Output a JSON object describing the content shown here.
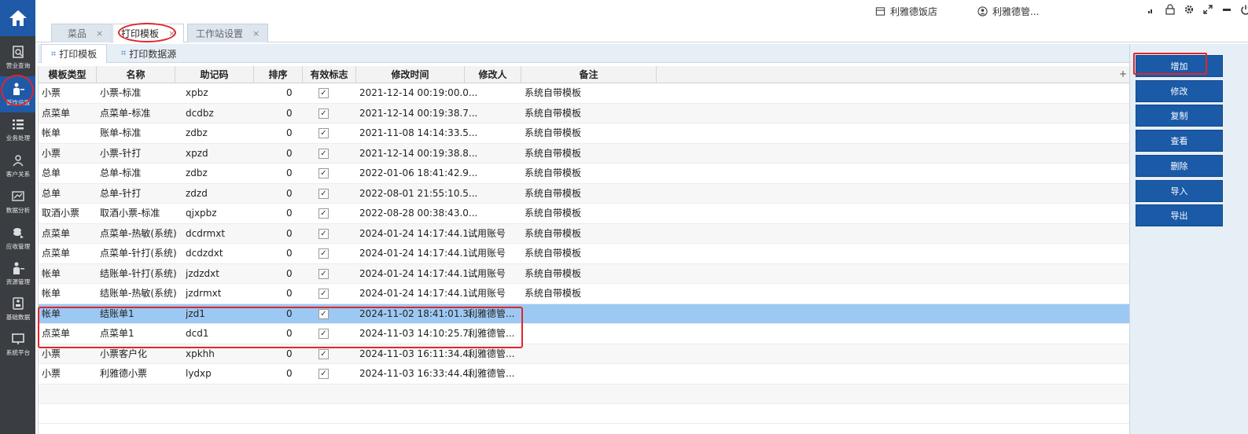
{
  "header": {
    "shop_name": "利雅德饭店",
    "user_name": "利雅德管..."
  },
  "nav": {
    "items": [
      {
        "label": "营业查询",
        "icon": "search-doc-icon"
      },
      {
        "label": "餐饮设置",
        "icon": "waiter-icon"
      },
      {
        "label": "业务处理",
        "icon": "list-icon"
      },
      {
        "label": "客户关系",
        "icon": "people-icon"
      },
      {
        "label": "数据分析",
        "icon": "chart-icon"
      },
      {
        "label": "应收管理",
        "icon": "coins-icon"
      },
      {
        "label": "资源管理",
        "icon": "person-icon"
      },
      {
        "label": "基础数据",
        "icon": "printer-icon"
      },
      {
        "label": "系统平台",
        "icon": "monitor-icon"
      }
    ]
  },
  "tabs": [
    {
      "label": "菜品",
      "close": "×"
    },
    {
      "label": "打印模板",
      "close": "×"
    },
    {
      "label": "工作站设置",
      "close": "×"
    }
  ],
  "subtabs": [
    {
      "label": "打印模板"
    },
    {
      "label": "打印数据源"
    }
  ],
  "table": {
    "columns": [
      "模板类型",
      "名称",
      "助记码",
      "排序",
      "有效标志",
      "修改时间",
      "修改人",
      "备注"
    ],
    "add_column": "+",
    "checkmark": "✓",
    "rows": [
      {
        "type": "小票",
        "name": "小票-标准",
        "code": "xpbz",
        "sort": "0",
        "time": "2021-12-14 00:19:00.0...",
        "modifier": "",
        "remark": "系统自带模板"
      },
      {
        "type": "点菜单",
        "name": "点菜单-标准",
        "code": "dcdbz",
        "sort": "0",
        "time": "2021-12-14 00:19:38.7...",
        "modifier": "",
        "remark": "系统自带模板"
      },
      {
        "type": "帐单",
        "name": "账单-标准",
        "code": "zdbz",
        "sort": "0",
        "time": "2021-11-08 14:14:33.5...",
        "modifier": "",
        "remark": "系统自带模板"
      },
      {
        "type": "小票",
        "name": "小票-针打",
        "code": "xpzd",
        "sort": "0",
        "time": "2021-12-14 00:19:38.8...",
        "modifier": "",
        "remark": "系统自带模板"
      },
      {
        "type": "总单",
        "name": "总单-标准",
        "code": "zdbz",
        "sort": "0",
        "time": "2022-01-06 18:41:42.9...",
        "modifier": "",
        "remark": "系统自带模板"
      },
      {
        "type": "总单",
        "name": "总单-针打",
        "code": "zdzd",
        "sort": "0",
        "time": "2022-08-01 21:55:10.5...",
        "modifier": "",
        "remark": "系统自带模板"
      },
      {
        "type": "取酒小票",
        "name": "取酒小票-标准",
        "code": "qjxpbz",
        "sort": "0",
        "time": "2022-08-28 00:38:43.0...",
        "modifier": "",
        "remark": "系统自带模板"
      },
      {
        "type": "点菜单",
        "name": "点菜单-热敏(系统)",
        "code": "dcdrmxt",
        "sort": "0",
        "time": "2024-01-24 14:17:44.1...",
        "modifier": "试用账号",
        "remark": "系统自带模板"
      },
      {
        "type": "点菜单",
        "name": "点菜单-针打(系统)",
        "code": "dcdzdxt",
        "sort": "0",
        "time": "2024-01-24 14:17:44.1...",
        "modifier": "试用账号",
        "remark": "系统自带模板"
      },
      {
        "type": "帐单",
        "name": "结账单-针打(系统)",
        "code": "jzdzdxt",
        "sort": "0",
        "time": "2024-01-24 14:17:44.1...",
        "modifier": "试用账号",
        "remark": "系统自带模板"
      },
      {
        "type": "帐单",
        "name": "结账单-热敏(系统)",
        "code": "jzdrmxt",
        "sort": "0",
        "time": "2024-01-24 14:17:44.1...",
        "modifier": "试用账号",
        "remark": "系统自带模板"
      },
      {
        "type": "帐单",
        "name": "结账单1",
        "code": "jzd1",
        "sort": "0",
        "time": "2024-11-02 18:41:01.3...",
        "modifier": "利雅德管...",
        "remark": ""
      },
      {
        "type": "点菜单",
        "name": "点菜单1",
        "code": "dcd1",
        "sort": "0",
        "time": "2024-11-03 14:10:25.7...",
        "modifier": "利雅德管...",
        "remark": ""
      },
      {
        "type": "小票",
        "name": "小票客户化",
        "code": "xpkhh",
        "sort": "0",
        "time": "2024-11-03 16:11:34.4...",
        "modifier": "利雅德管...",
        "remark": ""
      },
      {
        "type": "小票",
        "name": "利雅德小票",
        "code": "lydxp",
        "sort": "0",
        "time": "2024-11-03 16:33:44.4...",
        "modifier": "利雅德管...",
        "remark": ""
      }
    ],
    "selected_row": 11
  },
  "actions": [
    "增加",
    "修改",
    "复制",
    "查看",
    "删除",
    "导入",
    "导出"
  ],
  "colors": {
    "nav_bg": "#3a3d42",
    "brand_blue": "#1a5aa6",
    "selected_row": "#9cc9f3",
    "annotation_red": "#e0262a"
  }
}
